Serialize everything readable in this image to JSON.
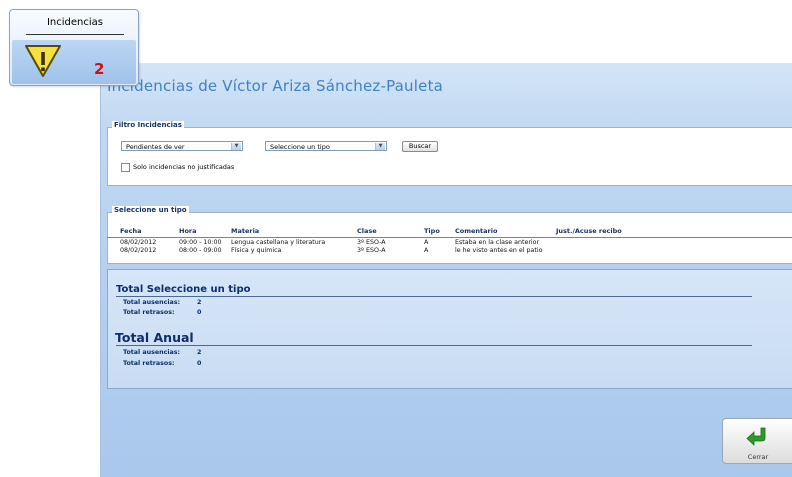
{
  "window": {
    "title": "Incidencias de Víctor Ariza Sánchez-Pauleta"
  },
  "filter": {
    "legend": "Filtro Incidencias",
    "view_select": "Pendientes de ver",
    "type_select": "Seleccione un tipo",
    "search_label": "Buscar",
    "checkbox_label": "Solo incidencias no justificadas"
  },
  "list": {
    "legend": "Seleccione un tipo",
    "columns": [
      "Fecha",
      "Hora",
      "Materia",
      "Clase",
      "Tipo",
      "Comentario",
      "Just./Acuse recibo"
    ],
    "rows": [
      [
        "08/02/2012",
        "09:00 - 10:00",
        "Lengua castellana y literatura",
        "3º ESO-A",
        "A",
        "Estaba en la clase anterior",
        ""
      ],
      [
        "08/02/2012",
        "08:00 - 09:00",
        "Física y química",
        "3º ESO-A",
        "A",
        "le he visto antes en el patio",
        ""
      ]
    ]
  },
  "totals": {
    "section1_title": "Total Seleccione un tipo",
    "section1_absences_label": "Total ausencias:",
    "section1_absences_value": "2",
    "section1_delays_label": "Total retrasos:",
    "section1_delays_value": "0",
    "section2_title": "Total Anual",
    "section2_absences_label": "Total ausencias:",
    "section2_absences_value": "2",
    "section2_delays_label": "Total retrasos:",
    "section2_delays_value": "0"
  },
  "close": {
    "label": "Cerrar",
    "icon": "return-arrow-icon"
  },
  "tile": {
    "title": "Incidencias",
    "count": "2",
    "icon": "warning-icon"
  },
  "colors": {
    "accent": "#3f82c8",
    "count": "#d01010",
    "close_arrow": "#2e9a27"
  }
}
